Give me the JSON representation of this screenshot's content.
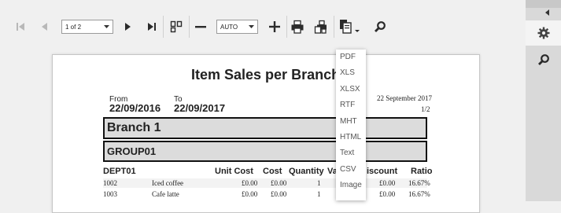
{
  "toolbar": {
    "page_select_value": "1 of 2",
    "zoom_select_value": "AUTO"
  },
  "icons": {
    "first": "first-page-icon",
    "prev": "previous-page-icon",
    "next": "next-page-icon",
    "last": "last-page-icon",
    "multi_page": "multi-page-icon",
    "zoom_out": "zoom-out-icon",
    "zoom_in": "zoom-in-icon",
    "print": "print-icon",
    "print_page": "print-page-icon",
    "export": "export-icon",
    "search": "search-icon",
    "settings": "gear-icon",
    "collapse": "chevron-left-icon"
  },
  "export_menu": [
    "PDF",
    "XLS",
    "XLSX",
    "RTF",
    "MHT",
    "HTML",
    "Text",
    "CSV",
    "Image"
  ],
  "report": {
    "title": "Item Sales per Branch",
    "from_label": "From",
    "from_date": "22/09/2016",
    "to_label": "To",
    "to_date": "22/09/2017",
    "print_date": "22 September 2017",
    "page_number": "1/2",
    "branch": "Branch 1",
    "group": "GROUP01",
    "columns": {
      "dept": "DEPT01",
      "unit_cost": "Unit Cost",
      "cost": "Cost",
      "quantity": "Quantity",
      "value": "Va",
      "discount": "iscount",
      "ratio": "Ratio"
    },
    "rows": [
      {
        "code": "1002",
        "name": "Iced coffee",
        "unit_cost": "£0.00",
        "cost": "£0.00",
        "quantity": "1",
        "discount": "£0.00",
        "ratio": "16.67%"
      },
      {
        "code": "1003",
        "name": "Cafe latte",
        "unit_cost": "£0.00",
        "cost": "£0.00",
        "quantity": "1",
        "discount": "£0.00",
        "ratio": "16.67%"
      }
    ]
  },
  "colors": {
    "toolbar_bg": "#f0f0f0",
    "panel_bg": "#d9d9d9",
    "group_box": "#dcdcdc",
    "icon_dark": "#2b2b2b",
    "icon_disabled": "#b8b8b8"
  }
}
